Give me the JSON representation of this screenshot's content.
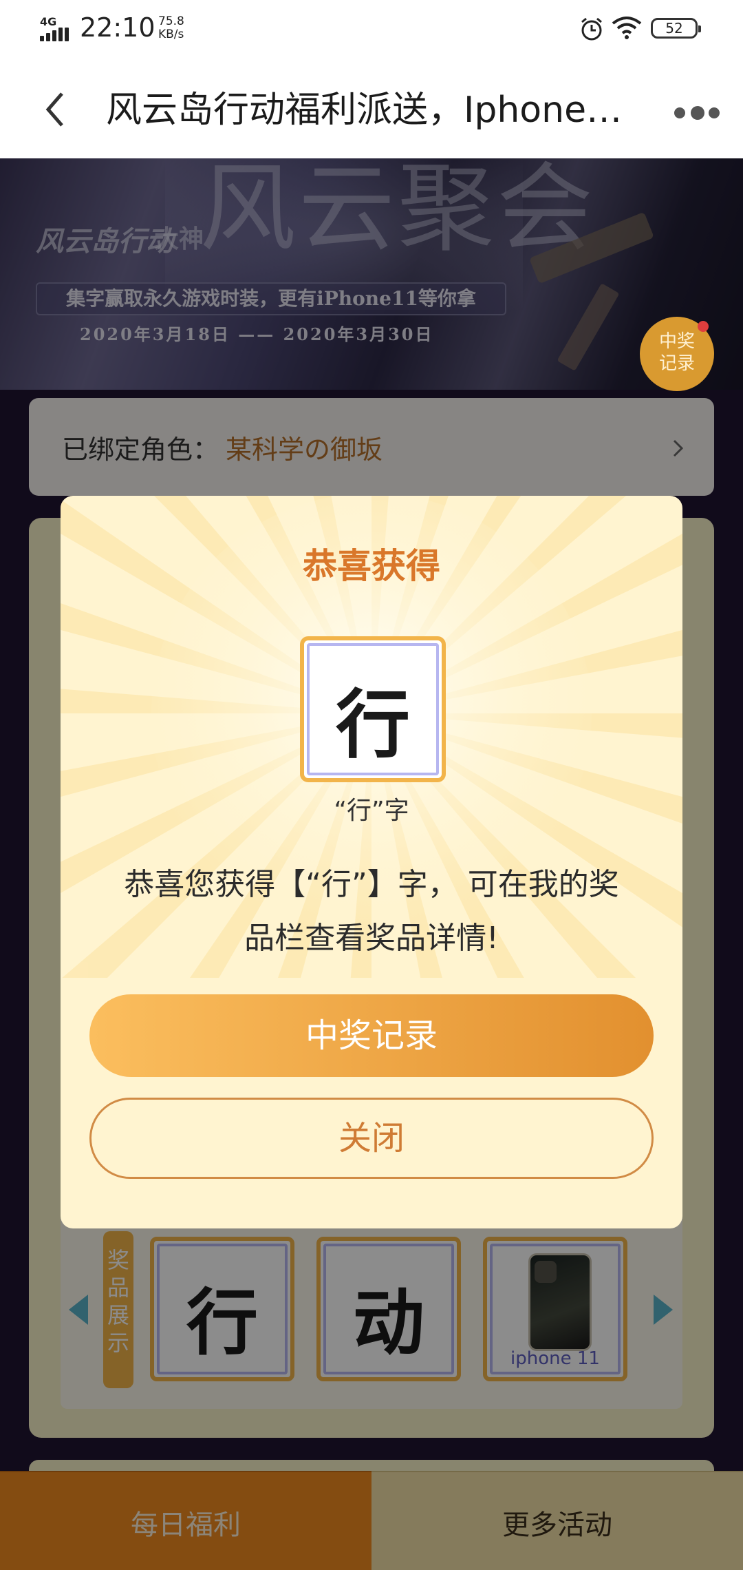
{
  "status_bar": {
    "network": "4G",
    "time": "22:10",
    "speed_value": "75.8",
    "speed_unit": "KB/s",
    "battery": "52",
    "icons": [
      "signal-icon",
      "alarm-icon",
      "wifi-icon",
      "battery-icon"
    ]
  },
  "header": {
    "title": "风云岛行动福利派送，Iphone…",
    "back_icon": "chevron-left-icon",
    "more_icon": "more-dots-icon"
  },
  "banner": {
    "big_title": "风云聚会",
    "logo": "风云岛行动",
    "partner": "大神",
    "slogan": "集字赢取永久游戏时装，更有iPhone11等你拿",
    "date_range": "2020年3月18日 —— 2020年3月30日",
    "record_badge": "中奖记录"
  },
  "role": {
    "label": "已绑定角色：",
    "name": "某科学の御坂"
  },
  "prize_display": {
    "label": "奖品展示",
    "items": [
      {
        "type": "character",
        "char": "行"
      },
      {
        "type": "character",
        "char": "动"
      },
      {
        "type": "phone",
        "label": "iphone 11"
      }
    ]
  },
  "modal": {
    "title": "恭喜获得",
    "char": "行",
    "caption": "“行”字",
    "message_line1": "恭喜您获得【“行”】字， 可在我的奖",
    "message_line2": "品栏查看奖品详情!",
    "record_button": "中奖记录",
    "close_button": "关闭"
  },
  "bottom_tabs": {
    "daily": "每日福利",
    "more": "更多活动"
  },
  "colors": {
    "accent": "#e2902f",
    "title_orange": "#d9772a",
    "tile_border": "#f2b44a",
    "arrow": "#5ab2c9"
  }
}
